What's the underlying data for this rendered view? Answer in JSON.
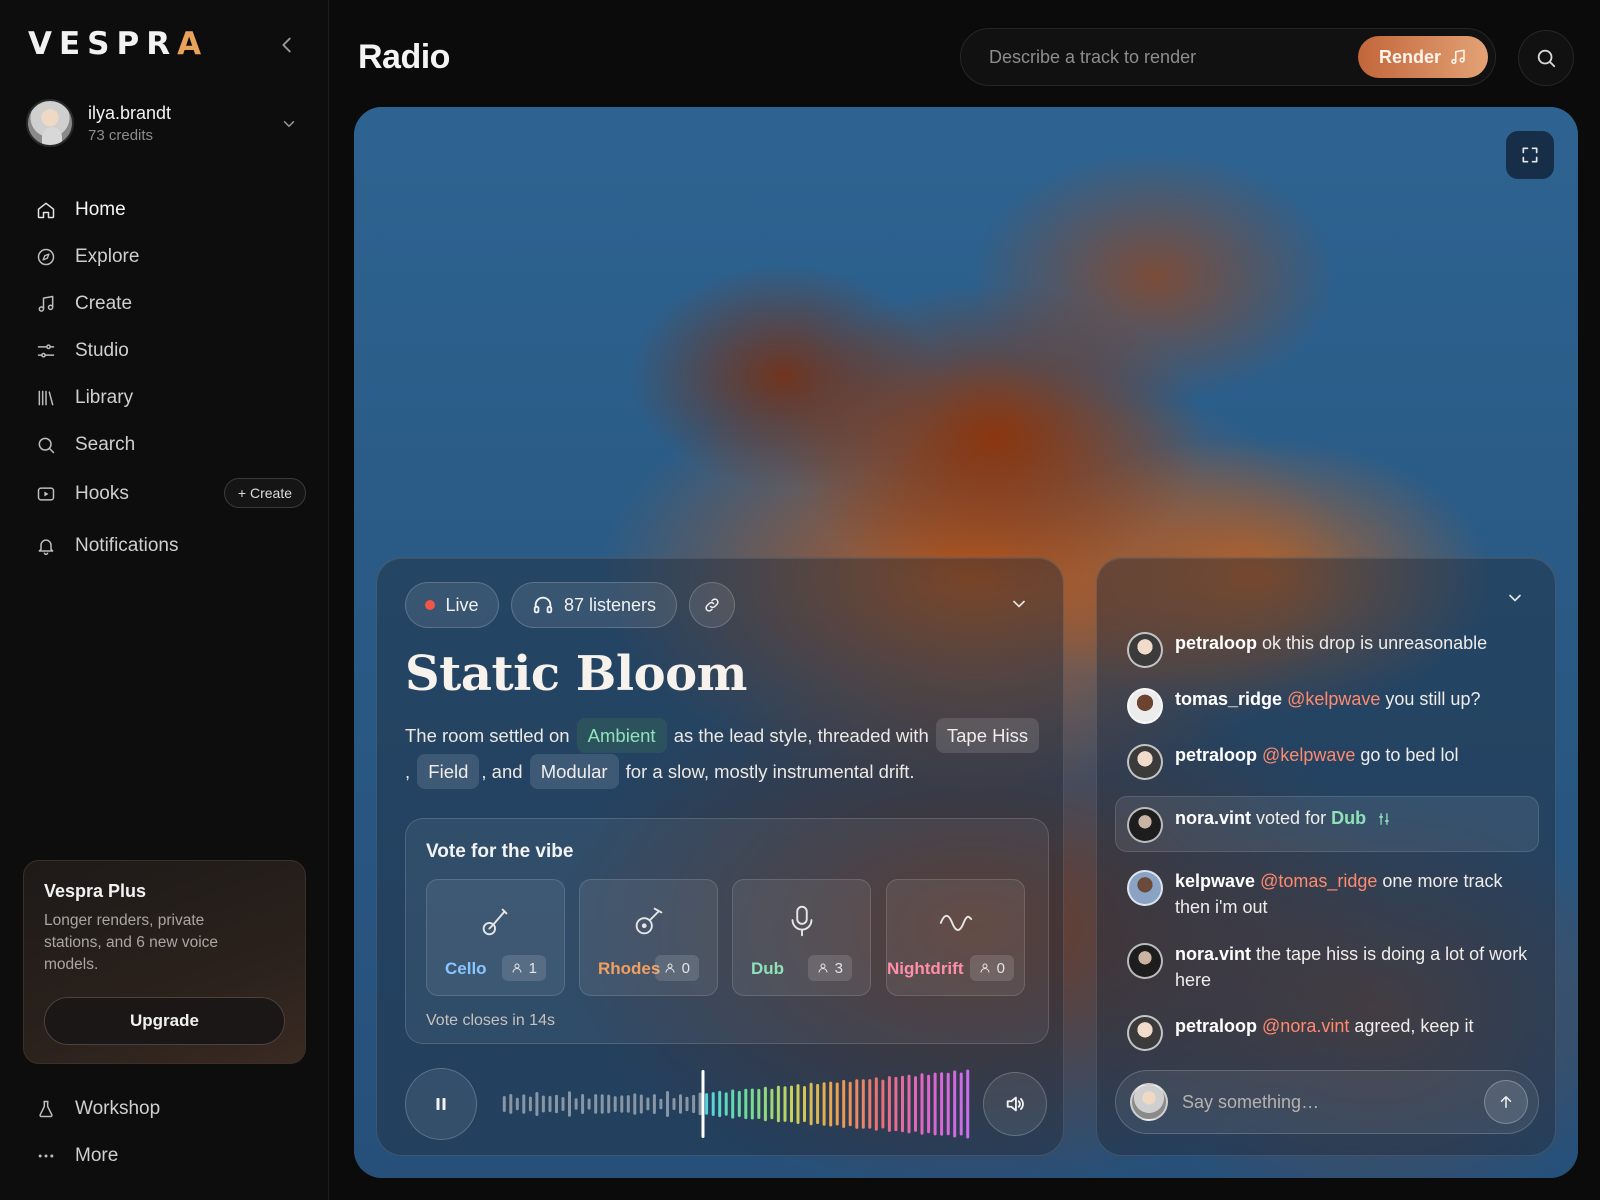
{
  "brand": {
    "logo_main": "VESPR",
    "logo_accent": "A"
  },
  "user": {
    "name": "ilya.brandt",
    "credits": "73 credits"
  },
  "nav": {
    "items": [
      {
        "label": "Home",
        "icon": "home-icon"
      },
      {
        "label": "Explore",
        "icon": "compass-icon"
      },
      {
        "label": "Create",
        "icon": "music-note-icon"
      },
      {
        "label": "Studio",
        "icon": "sliders-icon"
      },
      {
        "label": "Library",
        "icon": "library-icon"
      },
      {
        "label": "Search",
        "icon": "search-icon"
      },
      {
        "label": "Hooks",
        "icon": "play-square-icon",
        "action": "+ Create"
      },
      {
        "label": "Notifications",
        "icon": "bell-icon"
      }
    ],
    "bottom": [
      {
        "label": "Workshop",
        "icon": "flask-icon"
      },
      {
        "label": "More",
        "icon": "more-dots-icon"
      }
    ]
  },
  "plus": {
    "title": "Vespra Plus",
    "description": "Longer renders, private stations, and 6 new voice models.",
    "button": "Upgrade"
  },
  "header": {
    "title": "Radio",
    "prompt_placeholder": "Describe a track to render",
    "render_label": "Render"
  },
  "player": {
    "live_label": "Live",
    "listeners_label": "87 listeners",
    "title": "Static Bloom",
    "desc": {
      "p1": "The room settled on",
      "tag_lead": "Ambient",
      "p2": "as the lead style, threaded with",
      "tag1": "Tape Hiss",
      "p3": ",",
      "tag2": "Field",
      "p4": ", and",
      "tag3": "Modular",
      "p5": "for a slow, mostly instrumental drift."
    },
    "vote": {
      "title": "Vote for the vibe",
      "options": [
        {
          "name": "Cello",
          "count": "1",
          "color": "#8cc4ff",
          "icon": "guitar-icon"
        },
        {
          "name": "Rhodes",
          "count": "0",
          "color": "#f0a160",
          "icon": "piano-key-icon"
        },
        {
          "name": "Dub",
          "count": "3",
          "color": "#8fe2b8",
          "icon": "microphone-icon"
        },
        {
          "name": "Nightdrift",
          "count": "0",
          "color": "#ff8fa8",
          "icon": "wave-icon"
        }
      ],
      "closes": "Vote closes in 14s"
    },
    "progress": 0.43
  },
  "chat": {
    "messages": [
      {
        "user": "petraloop",
        "mention": "",
        "text": "ok this drop is unreasonable",
        "avatar": "#d9c6b8"
      },
      {
        "user": "tomas_ridge",
        "mention": "@kelpwave",
        "text": "you still up?",
        "avatar": "#5a3a2a"
      },
      {
        "user": "petraloop",
        "mention": "@kelpwave",
        "text": "go to bed lol",
        "avatar": "#d9c6b8"
      },
      {
        "user": "nora.vint",
        "mention": "",
        "text": "voted for",
        "vote": "Dub",
        "avatar": "#2b2b2b"
      },
      {
        "user": "kelpwave",
        "mention": "@tomas_ridge",
        "text": "one more track then i'm out",
        "avatar": "#7a93b5"
      },
      {
        "user": "nora.vint",
        "mention": "",
        "text": "the tape hiss is doing a lot of work here",
        "avatar": "#2b2b2b"
      },
      {
        "user": "petraloop",
        "mention": "@nora.vint",
        "text": "agreed, keep it",
        "avatar": "#d9c6b8"
      }
    ],
    "input_placeholder": "Say something…"
  },
  "colors": {
    "accent": "#e8a25a",
    "render_start": "#c2663a",
    "render_end": "#e3a275",
    "mention": "#ff8a6e",
    "live": "#f0554a"
  }
}
